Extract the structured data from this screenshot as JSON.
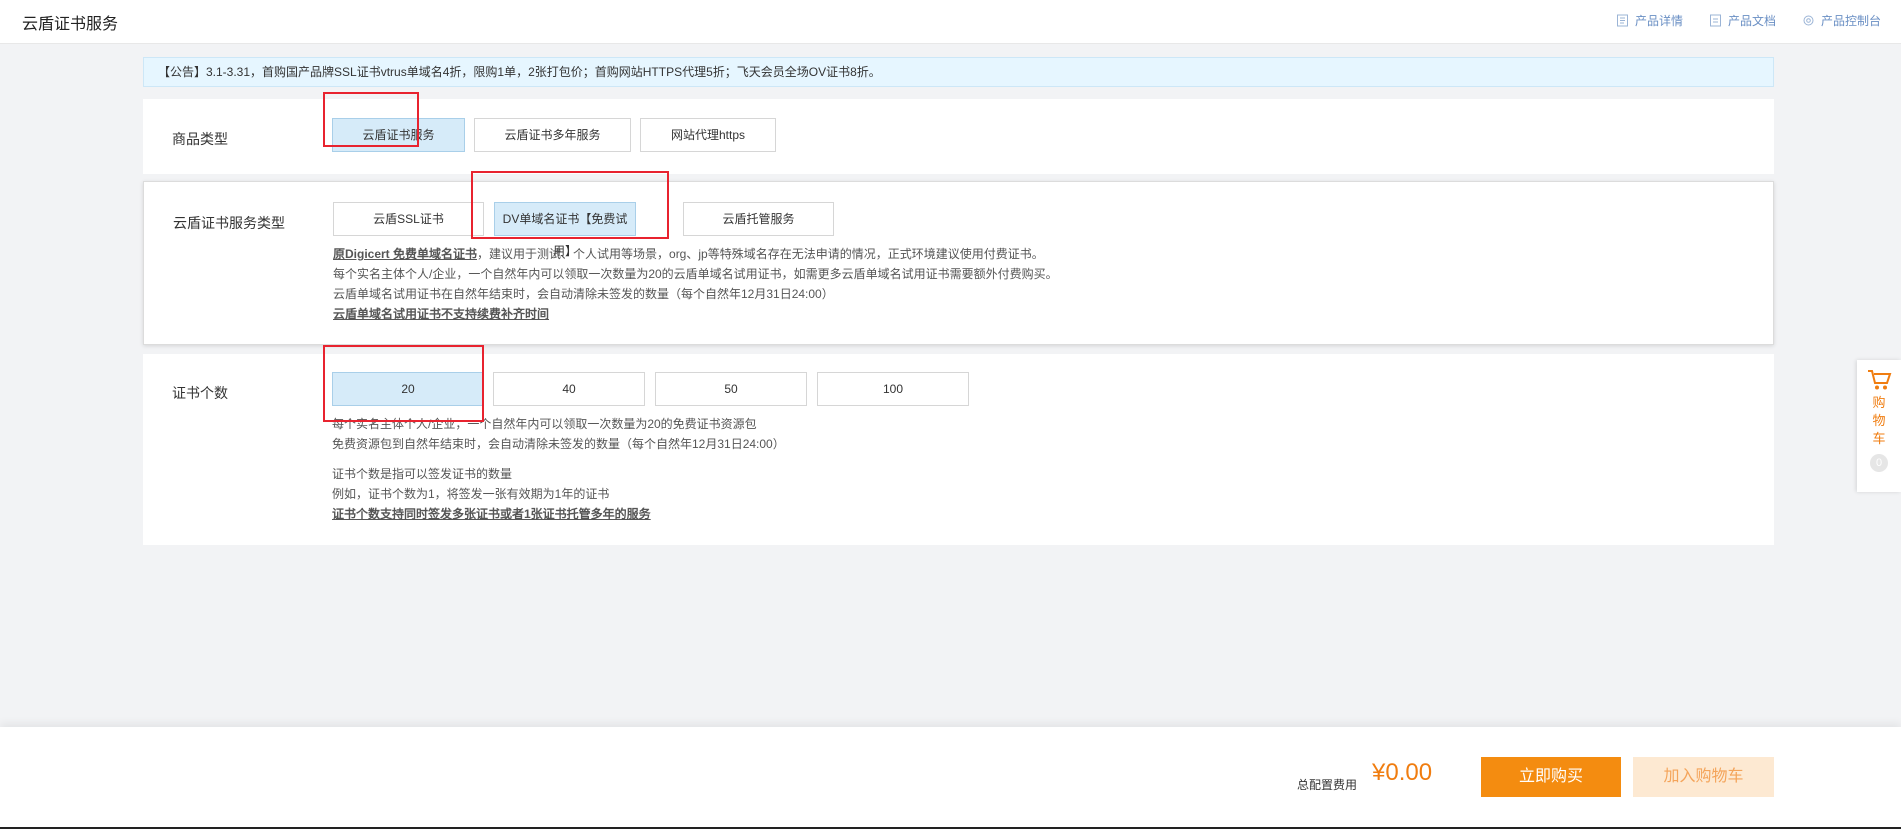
{
  "header": {
    "title": "云盾证书服务",
    "links": [
      {
        "label": "产品详情",
        "icon": "document-icon"
      },
      {
        "label": "产品文档",
        "icon": "file-icon"
      },
      {
        "label": "产品控制台",
        "icon": "gear-icon"
      }
    ]
  },
  "notice": "【公告】3.1-3.31，首购国产品牌SSL证书vtrus单域名4折，限购1单，2张打包价；首购网站HTTPS代理5折；飞天会员全场OV证书8折。",
  "product_type": {
    "label": "商品类型",
    "options": [
      "云盾证书服务",
      "云盾证书多年服务",
      "网站代理https"
    ],
    "selected": "云盾证书服务"
  },
  "service_type": {
    "label": "云盾证书服务类型",
    "options": [
      "云盾SSL证书",
      "DV单域名证书【免费试用】",
      "云盾托管服务"
    ],
    "selected": "DV单域名证书【免费试用】",
    "desc_line1_link": "原Digicert 免费单域名证书",
    "desc_line1_rest": "，建议用于测试、个人试用等场景，org、jp等特殊域名存在无法申请的情况，正式环境建议使用付费证书。",
    "desc_line2": "每个实名主体个人/企业，一个自然年内可以领取一次数量为20的云盾单域名试用证书，如需更多云盾单域名试用证书需要额外付费购买。",
    "desc_line3": "云盾单域名试用证书在自然年结束时，会自动清除未签发的数量（每个自然年12月31日24:00）",
    "desc_line4": "云盾单域名试用证书不支持续费补齐时间"
  },
  "cert_count": {
    "label": "证书个数",
    "options": [
      "20",
      "40",
      "50",
      "100"
    ],
    "selected": "20",
    "desc_line1": "每个实名主体个人/企业，一个自然年内可以领取一次数量为20的免费证书资源包",
    "desc_line2": "免费资源包到自然年结束时，会自动清除未签发的数量（每个自然年12月31日24:00）",
    "desc_line3": "证书个数是指可以签发证书的数量",
    "desc_line4": "例如，证书个数为1，将签发一张有效期为1年的证书",
    "desc_line5": "证书个数支持同时签发多张证书或者1张证书托管多年的服务"
  },
  "cart_float": {
    "label_chars": [
      "购",
      "物",
      "车"
    ],
    "count": "0"
  },
  "footer": {
    "total_label": "总配置费用",
    "price": "¥0.00",
    "buy_label": "立即购买",
    "add_cart_label": "加入购物车"
  },
  "colors": {
    "accent": "#f48c10",
    "selected_bg": "#d6ebf9",
    "annotation_red": "#e8232f"
  }
}
